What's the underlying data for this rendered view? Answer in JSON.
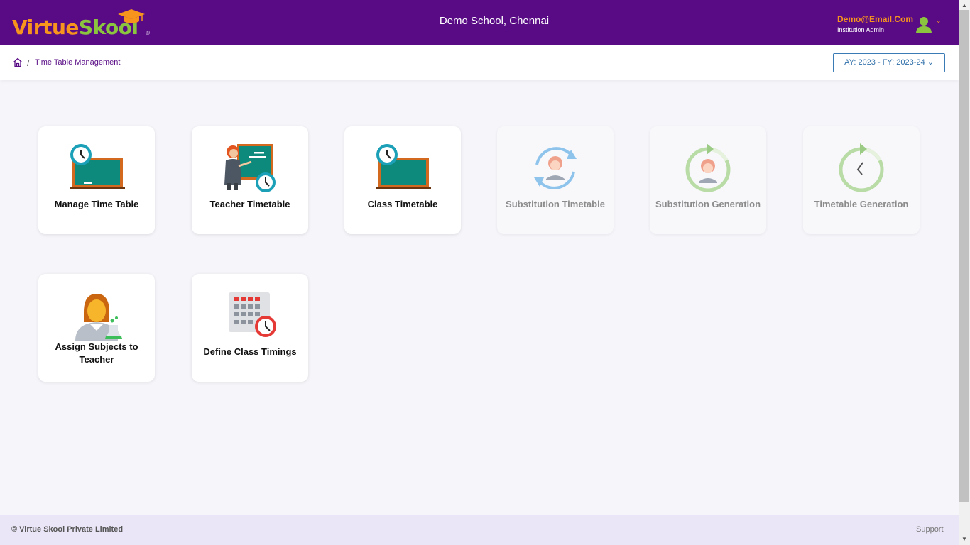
{
  "header": {
    "logo_text_a": "Virtue",
    "logo_text_b": "Skool",
    "logo_reg": "®",
    "school_name": "Demo School, Chennai",
    "user_email": "Demo@Email.Com",
    "user_role": "Institution Admin",
    "caret": "⌄"
  },
  "breadcrumb": {
    "separator": "/",
    "current": "Time Table Management"
  },
  "year_select": {
    "value": "AY: 2023 - FY: 2023-24 ⌄"
  },
  "cards": [
    {
      "label": "Manage Time Table",
      "icon": "clock-board-icon"
    },
    {
      "label": "Teacher Timetable",
      "icon": "teacher-board-icon"
    },
    {
      "label": "Class Timetable",
      "icon": "clock-board-icon"
    },
    {
      "label": "Substitution Timetable",
      "icon": "substitution-cycle-icon"
    },
    {
      "label": "Substitution Generation",
      "icon": "substitution-generation-icon"
    },
    {
      "label": "Timetable Generation",
      "icon": "clock-cycle-icon"
    },
    {
      "label": "Assign Subjects to Teacher",
      "icon": "teacher-flask-icon"
    },
    {
      "label": "Define Class Timings",
      "icon": "calendar-clock-icon"
    }
  ],
  "footer": {
    "copyright": "© Virtue Skool Private Limited",
    "support": "Support"
  },
  "colors": {
    "brand_purple": "#580b85",
    "brand_orange": "#f7941e",
    "brand_green": "#8bc53f"
  }
}
